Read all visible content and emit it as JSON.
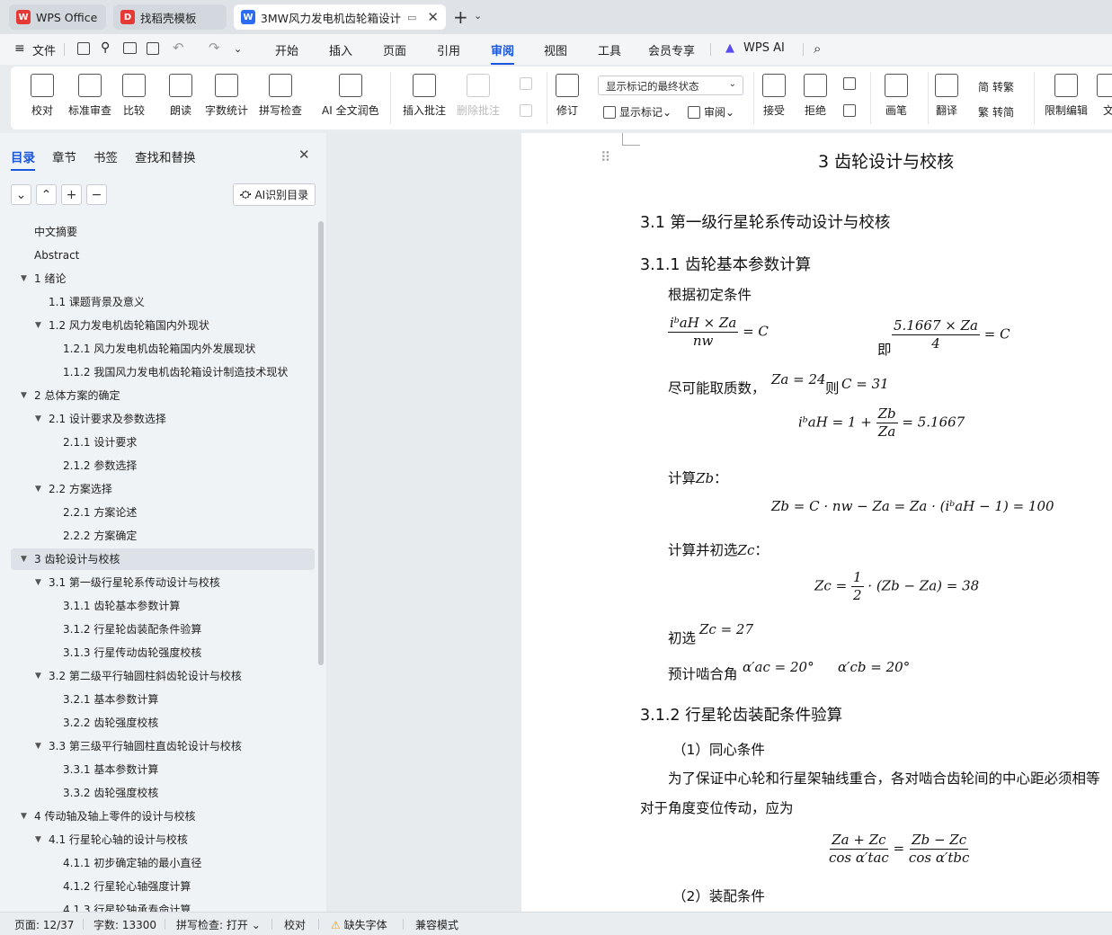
{
  "tabs": [
    {
      "label": "WPS Office",
      "icon": "wps-logo-icon",
      "color": "#e53935"
    },
    {
      "label": "找稻壳模板",
      "icon": "docer-icon",
      "color": "#e53935"
    },
    {
      "label": "3MW风力发电机齿轮箱设计",
      "icon": "word-doc-icon",
      "color": "#2b6cf0"
    }
  ],
  "menu": {
    "file": "文件",
    "items": [
      "开始",
      "插入",
      "页面",
      "引用",
      "审阅",
      "视图",
      "工具",
      "会员专享"
    ],
    "selected": "审阅",
    "wps_ai": "WPS AI"
  },
  "ribbon": {
    "buttons": [
      "校对",
      "标准审查",
      "比较",
      "朗读",
      "字数统计",
      "拼写检查",
      "AI 全文润色",
      "插入批注",
      "删除批注",
      "修订",
      "画笔",
      "翻译",
      "限制编辑",
      "文"
    ],
    "combo": "显示标记的最终状态",
    "show_markup": "显示标记",
    "review_pane": "审阅",
    "accept": "接受",
    "reject": "拒绝",
    "to_traditional": "转繁",
    "to_simplified": "转简",
    "trad_glyph": "繁",
    "simp_glyph": "简"
  },
  "nav": {
    "tabs": [
      "目录",
      "章节",
      "书签",
      "查找和替换"
    ],
    "ai_toc": "AI识别目录",
    "items": [
      {
        "label": "中文摘要",
        "level": 0,
        "arrow": ""
      },
      {
        "label": "Abstract",
        "level": 0,
        "arrow": ""
      },
      {
        "label": "1  绪论",
        "level": 0,
        "arrow": "▼"
      },
      {
        "label": "1.1 课题背景及意义",
        "level": 1,
        "arrow": ""
      },
      {
        "label": "1.2 风力发电机齿轮箱国内外现状",
        "level": 1,
        "arrow": "▼"
      },
      {
        "label": "1.2.1 风力发电机齿轮箱国内外发展现状",
        "level": 2,
        "arrow": ""
      },
      {
        "label": "1.1.2 我国风力发电机齿轮箱设计制造技术现状",
        "level": 2,
        "arrow": ""
      },
      {
        "label": "2  总体方案的确定",
        "level": 0,
        "arrow": "▼"
      },
      {
        "label": "2.1 设计要求及参数选择",
        "level": 1,
        "arrow": "▼"
      },
      {
        "label": "2.1.1 设计要求",
        "level": 2,
        "arrow": ""
      },
      {
        "label": "2.1.2 参数选择",
        "level": 2,
        "arrow": ""
      },
      {
        "label": "2.2 方案选择",
        "level": 1,
        "arrow": "▼"
      },
      {
        "label": "2.2.1 方案论述",
        "level": 2,
        "arrow": ""
      },
      {
        "label": "2.2.2 方案确定",
        "level": 2,
        "arrow": ""
      },
      {
        "label": "3  齿轮设计与校核",
        "level": 0,
        "arrow": "▼"
      },
      {
        "label": "3.1 第一级行星轮系传动设计与校核",
        "level": 1,
        "arrow": "▼"
      },
      {
        "label": "3.1.1 齿轮基本参数计算",
        "level": 2,
        "arrow": ""
      },
      {
        "label": "3.1.2 行星轮齿装配条件验算",
        "level": 2,
        "arrow": ""
      },
      {
        "label": "3.1.3 行星传动齿轮强度校核",
        "level": 2,
        "arrow": ""
      },
      {
        "label": "3.2 第二级平行轴圆柱斜齿轮设计与校核",
        "level": 1,
        "arrow": "▼"
      },
      {
        "label": "3.2.1 基本参数计算",
        "level": 2,
        "arrow": ""
      },
      {
        "label": "3.2.2 齿轮强度校核",
        "level": 2,
        "arrow": ""
      },
      {
        "label": "3.3 第三级平行轴圆柱直齿轮设计与校核",
        "level": 1,
        "arrow": "▼"
      },
      {
        "label": "3.3.1 基本参数计算",
        "level": 2,
        "arrow": ""
      },
      {
        "label": "3.3.2 齿轮强度校核",
        "level": 2,
        "arrow": ""
      },
      {
        "label": "4 传动轴及轴上零件的设计与校核",
        "level": 0,
        "arrow": "▼"
      },
      {
        "label": "4.1 行星轮心轴的设计与校核",
        "level": 1,
        "arrow": "▼"
      },
      {
        "label": "4.1.1 初步确定轴的最小直径",
        "level": 2,
        "arrow": ""
      },
      {
        "label": "4.1.2 行星轮心轴强度计算",
        "level": 2,
        "arrow": ""
      },
      {
        "label": "4.1.3 行星轮轴承寿命计算",
        "level": 2,
        "arrow": ""
      }
    ],
    "selected_index": 14
  },
  "doc": {
    "h_chapter": "3  齿轮设计与校核",
    "h_31": "3.1 第一级行星轮系传动设计与校核",
    "h_311": "3.1.1 齿轮基本参数计算",
    "p_initial": "根据初定条件",
    "eq1_num": "iᵇaH × Za",
    "eq1_den": "nw",
    "eq1_rhs": "= C",
    "ji": "即",
    "eq2_num": "5.1667 × Za",
    "eq2_den": "4",
    "eq2_rhs": "= C",
    "p_take": "尽可能取质数，",
    "za_eq": "Za = 24",
    "ze": "则",
    "c_eq": "C = 31",
    "eq3_lhs": "iᵇaH = 1 +",
    "eq3_num": "Zb",
    "eq3_den": "Za",
    "eq3_rhs": "= 5.1667",
    "p_calc_zb": "计算",
    "zb_sym": "Zb",
    "colon": "：",
    "eq4": "Zb = C · nw − Za = Za · (iᵇaH − 1) = 100",
    "p_calc_zc": "计算并初选",
    "zc_sym": "Zc",
    "eq5_lhs": "Zc =",
    "eq5_num": "1",
    "eq5_den": "2",
    "eq5_rhs": "· (Zb − Za) = 38",
    "p_choose": "初选",
    "zc_eq": "Zc = 27",
    "p_angle": "预计啮合角",
    "ang1": "α′ac = 20°",
    "ang2": "α′cb = 20°",
    "h_312": "3.1.2 行星轮齿装配条件验算",
    "cond1": "（1）同心条件",
    "p_cond1a": "为了保证中心轮和行星架轴线重合，各对啮合齿轮间的中心距必须相等",
    "p_cond1b": "对于角度变位传动，应为",
    "eq6_num1": "Za + Zc",
    "eq6_den1": "cos α′tac",
    "eq6_num2": "Zb − Zc",
    "eq6_den2": "cos α′tbc",
    "cond2": "（2）装配条件",
    "paren1": "（",
    "paren2": "（"
  },
  "status": {
    "page": "页面: 12/37",
    "words": "字数: 13300",
    "spell": "拼写检查: 打开",
    "proof": "校对",
    "missing_font": "缺失字体",
    "compat": "兼容模式"
  },
  "colors": {
    "accent": "#1a56db",
    "wps_red": "#e53935",
    "warning": "#f0a000"
  }
}
